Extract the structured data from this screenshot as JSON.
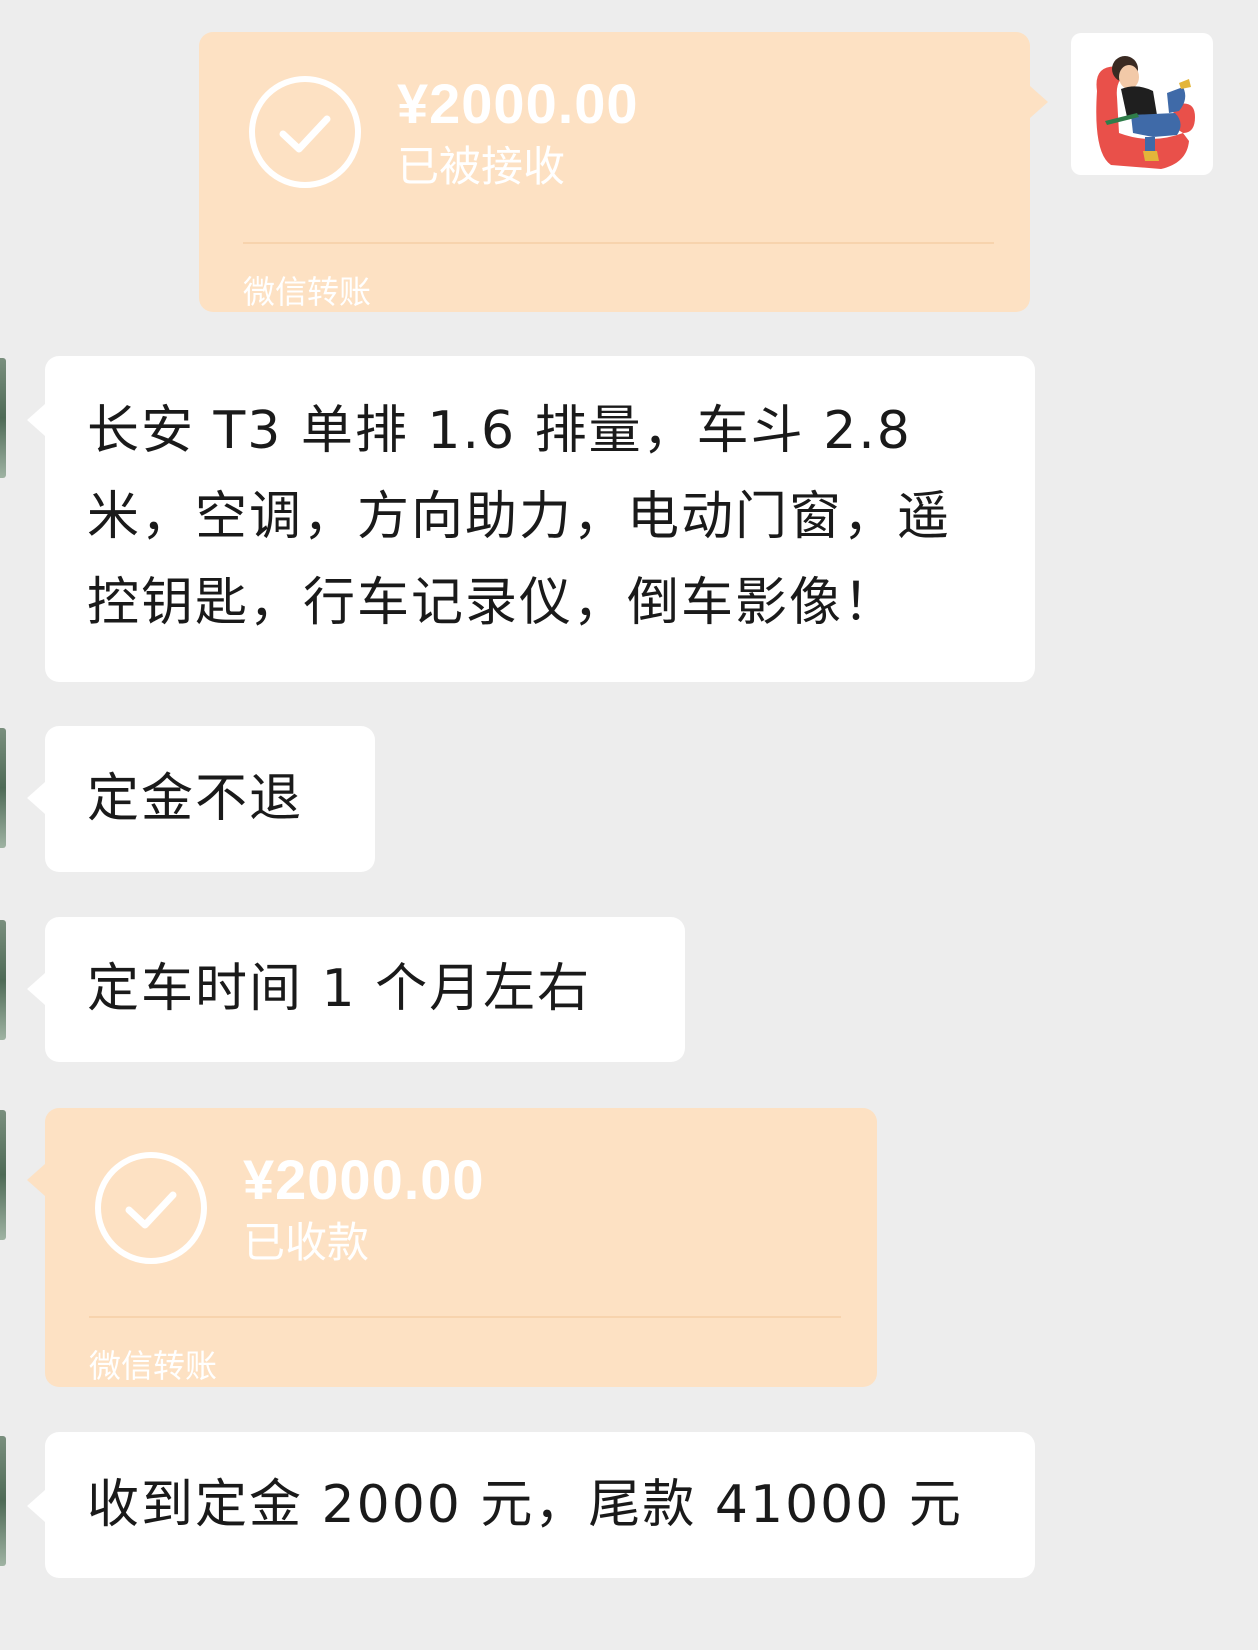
{
  "messages": [
    {
      "type": "transfer",
      "direction": "outgoing",
      "amount": "¥2000.00",
      "status": "已被接收",
      "brand": "微信转账"
    },
    {
      "type": "text",
      "direction": "incoming",
      "lines": [
        "长安 T3 单排 1.6 排量，车斗 2.8",
        "米，空调，方向助力，电动门窗，遥",
        "控钥匙，行车记录仪，倒车影像！"
      ]
    },
    {
      "type": "text",
      "direction": "incoming",
      "text": "定金不退"
    },
    {
      "type": "text",
      "direction": "incoming",
      "text": "定车时间 1 个月左右"
    },
    {
      "type": "transfer",
      "direction": "incoming",
      "amount": "¥2000.00",
      "status": "已收款",
      "brand": "微信转账"
    },
    {
      "type": "text",
      "direction": "incoming",
      "text": "收到定金 2000 元，尾款 41000 元"
    }
  ],
  "colors": {
    "background": "#ededed",
    "transfer_bubble": "#fde1c3",
    "text_bubble": "#ffffff",
    "text": "#1a1a1a"
  },
  "icons": {
    "check": "check-circle-icon",
    "avatar": "user-avatar-illustration"
  }
}
